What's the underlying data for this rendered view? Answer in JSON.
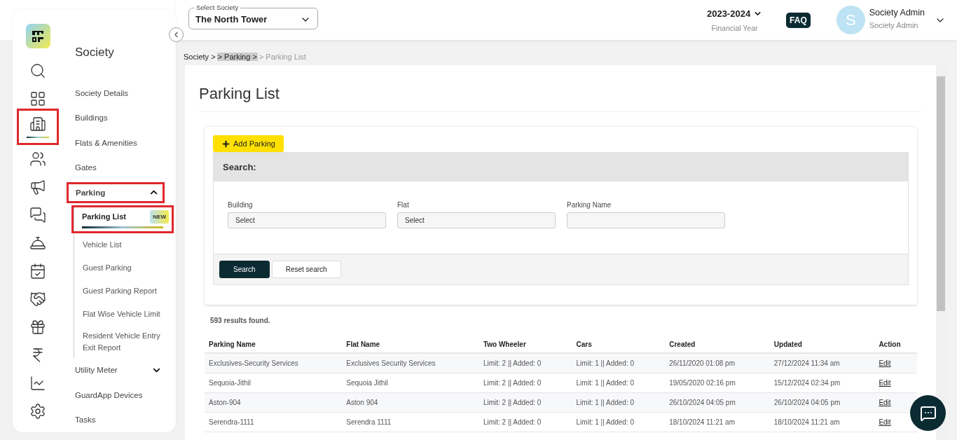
{
  "rail": [
    {
      "selected": false,
      "highlighted": false
    },
    {
      "selected": false,
      "highlighted": false
    },
    {
      "selected": true,
      "highlighted": true
    },
    {
      "selected": false,
      "highlighted": false
    },
    {
      "selected": false,
      "highlighted": false
    },
    {
      "selected": false,
      "highlighted": false
    },
    {
      "selected": false,
      "highlighted": false
    },
    {
      "selected": false,
      "highlighted": false
    },
    {
      "selected": false,
      "highlighted": false
    },
    {
      "selected": false,
      "highlighted": false
    },
    {
      "selected": false,
      "highlighted": false
    },
    {
      "selected": false,
      "highlighted": false
    },
    {
      "selected": false,
      "highlighted": false
    }
  ],
  "sidebar": {
    "title": "Society",
    "items": [
      {
        "label": "Society Details"
      },
      {
        "label": "Buildings"
      },
      {
        "label": "Flats & Amenities"
      },
      {
        "label": "Gates"
      },
      {
        "label": "Parking",
        "expanded": true,
        "highlighted": true,
        "children": [
          {
            "label": "Parking List",
            "selected": true,
            "highlighted": true,
            "badge": "NEW"
          },
          {
            "label": "Vehicle List",
            "selected": false,
            "highlighted": false
          },
          {
            "label": "Guest Parking",
            "selected": false,
            "highlighted": false
          },
          {
            "label": "Guest Parking Report",
            "selected": false,
            "highlighted": false
          },
          {
            "label": "Flat Wise Vehicle Limit",
            "selected": false,
            "highlighted": false
          },
          {
            "label": "Resident Vehicle Entry Exit Report",
            "selected": false,
            "highlighted": false
          }
        ]
      },
      {
        "label": "Utility Meter",
        "expanded": false,
        "highlighted": false
      },
      {
        "label": "GuardApp Devices"
      },
      {
        "label": "Tasks"
      }
    ]
  },
  "header": {
    "society_select": {
      "label": "Select Society",
      "value": "The North Tower"
    },
    "financial_year": {
      "value": "2023-2024",
      "caption": "Financial Year"
    },
    "faq": "FAQ",
    "user": {
      "initial": "S",
      "name": "Society Admin",
      "role": "Society Admin"
    }
  },
  "breadcrumb": [
    {
      "text": "Society >",
      "kind": "link"
    },
    {
      "text": "> Parking >",
      "kind": "highlighted"
    },
    {
      "text": "> Parking List",
      "kind": "current"
    }
  ],
  "page_title": "Parking List",
  "add_button": "Add Parking",
  "search": {
    "title": "Search:",
    "fields": [
      {
        "label": "Building",
        "value": "Select"
      },
      {
        "label": "Flat",
        "value": "Select"
      },
      {
        "label": "Parking Name"
      }
    ],
    "search_button": "Search",
    "reset_button": "Reset search"
  },
  "results_count": "593 results found.",
  "table": {
    "columns": [
      "Parking Name",
      "Flat Name",
      "Two Wheeler",
      "Cars",
      "Created",
      "Updated",
      "Action"
    ],
    "rows": [
      [
        "Exclusives-Security Services",
        "Exclusives Security Services",
        "Limit: 2 || Added: 0",
        "Limit: 1 || Added: 0",
        "26/11/2020 01:08 pm",
        "27/12/2024 11:34 am",
        "Edit"
      ],
      [
        "Sequoia-Jithil",
        "Sequoia Jithil",
        "Limit: 2 || Added: 0",
        "Limit: 1 || Added: 0",
        "19/05/2020 02:16 pm",
        "15/12/2024 02:34 pm",
        "Edit"
      ],
      [
        "Aston-904",
        "Aston 904",
        "Limit: 2 || Added: 0",
        "Limit: 1 || Added: 0",
        "26/10/2024 04:05 pm",
        "26/10/2024 04:05 pm",
        "Edit"
      ],
      [
        "Serendra-1111",
        "Serendra 1111",
        "Limit: 2 || Added: 0",
        "Limit: 1 || Added: 0",
        "18/10/2024 11:21 am",
        "18/10/2024 11:21 am",
        "Edit"
      ]
    ]
  }
}
